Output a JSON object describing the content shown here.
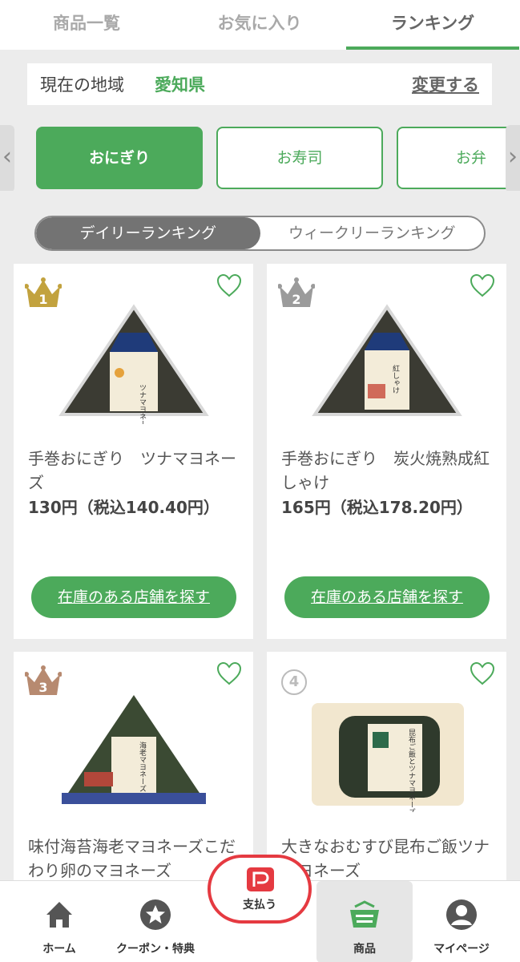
{
  "top_tabs": [
    {
      "label": "商品一覧"
    },
    {
      "label": "お気に入り"
    },
    {
      "label": "ランキング"
    }
  ],
  "region": {
    "label": "現在の地域",
    "value": "愛知県",
    "change": "変更する"
  },
  "categories": [
    {
      "label": "おにぎり"
    },
    {
      "label": "お寿司"
    },
    {
      "label": "お弁"
    }
  ],
  "ranking_toggle": {
    "daily": "デイリーランキング",
    "weekly": "ウィークリーランキング"
  },
  "products": [
    {
      "rank": "1",
      "name": "手巻おにぎり　ツナマヨネーズ",
      "price": "130円（税込140.40円）",
      "stock": "在庫のある店舗を探す",
      "crown_color": "#c2a23e",
      "package_label": "ツナマヨネーズ"
    },
    {
      "rank": "2",
      "name": "手巻おにぎり　炭火焼熟成紅しゃけ",
      "price": "165円（税込178.20円）",
      "stock": "在庫のある店舗を探す",
      "crown_color": "#9b9b9b",
      "package_label": "紅しゃけ"
    },
    {
      "rank": "3",
      "name": "味付海苔海老マヨネーズこだわり卵のマヨネーズ",
      "price": "",
      "stock": "",
      "crown_color": "#b78a70",
      "package_label": "海老マヨネーズ"
    },
    {
      "rank": "4",
      "name": "大きなおむすび昆布ご飯ツナマヨネーズ",
      "price": "",
      "stock": "",
      "crown_color": "",
      "package_label": "昆布ご飯とツナマヨネーズ"
    }
  ],
  "bottom_nav": {
    "home": "ホーム",
    "coupon": "クーポン・特典",
    "pay": "支払う",
    "products": "商品",
    "mypage": "マイページ"
  },
  "colors": {
    "accent": "#4caa5b",
    "pay_red": "#e53a41"
  }
}
